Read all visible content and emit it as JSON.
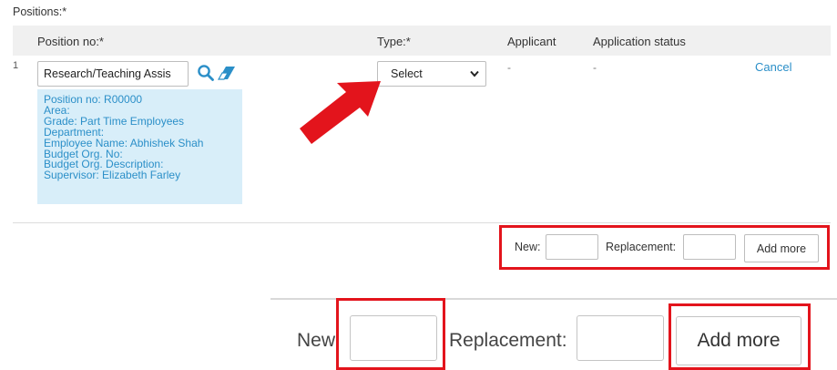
{
  "section": {
    "label": "Positions:*"
  },
  "table": {
    "headers": {
      "position_no": "Position no:*",
      "type": "Type:*",
      "applicant": "Applicant",
      "application_status": "Application status"
    },
    "row": {
      "number": "1",
      "position_value": "Research/Teaching Assis",
      "info_lines": [
        "Position no: R00000",
        "Area:",
        "Grade: Part Time Employees",
        "Department:",
        "Employee Name: Abhishek Shah",
        "Budget Org. No:",
        "Budget Org. Description:",
        "Supervisor: Elizabeth Farley"
      ],
      "type_selected": "Select",
      "applicant": "-",
      "application_status": "-",
      "cancel_label": "Cancel"
    }
  },
  "add_more_small": {
    "new_label": "New:",
    "replacement_label": "Replacement:",
    "button_label": "Add more"
  },
  "add_more_zoomed": {
    "new_label": "New",
    "replacement_label": "Replacement:",
    "button_label": "Add more"
  },
  "colors": {
    "highlight": "#e3141c",
    "arrow": "#e3141c",
    "link": "#2b8fc8",
    "info_bg": "#d8eef9"
  },
  "icons": [
    "search-icon",
    "eraser-icon",
    "chevron-down-icon",
    "pointer-arrow-icon"
  ]
}
